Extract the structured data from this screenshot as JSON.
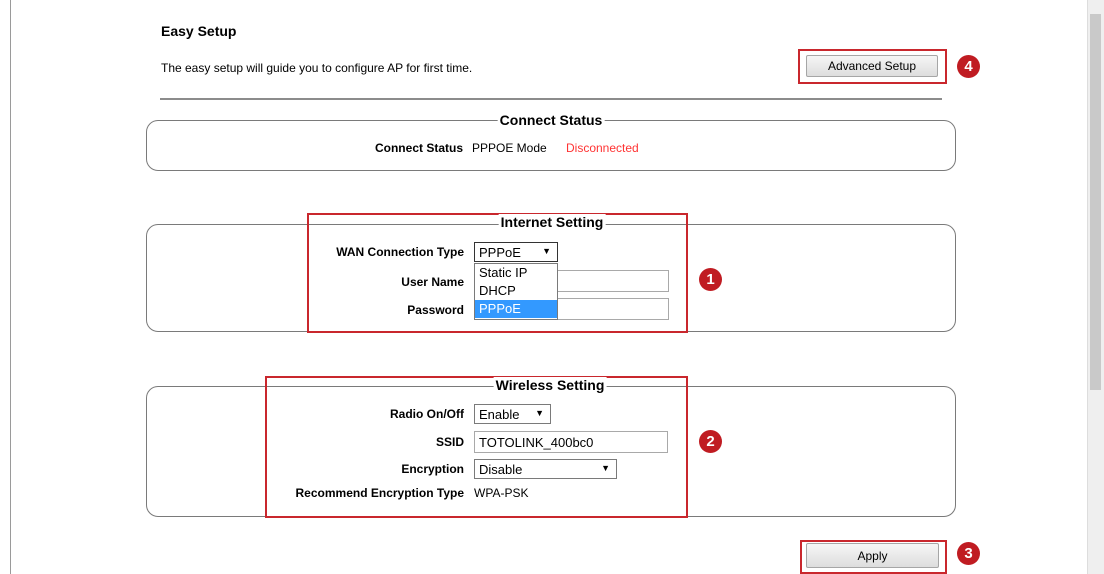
{
  "header": {
    "title": "Easy Setup",
    "description": "The easy setup will guide you to configure AP for first time.",
    "advanced_button": "Advanced Setup"
  },
  "connect_status": {
    "legend": "Connect Status",
    "label": "Connect Status",
    "mode": "PPPOE Mode",
    "state": "Disconnected",
    "state_color": "#ff3333"
  },
  "internet": {
    "legend": "Internet Setting",
    "wan_label": "WAN Connection Type",
    "wan_value": "PPPoE",
    "wan_options": [
      "Static IP",
      "DHCP",
      "PPPoE"
    ],
    "user_label": "User Name",
    "password_label": "Password"
  },
  "wireless": {
    "legend": "Wireless Setting",
    "radio_label": "Radio On/Off",
    "radio_value": "Enable",
    "ssid_label": "SSID",
    "ssid_value": "TOTOLINK_400bc0",
    "encryption_label": "Encryption",
    "encryption_value": "Disable",
    "recommend_label": "Recommend Encryption Type",
    "recommend_value": "WPA-PSK"
  },
  "apply_button": "Apply",
  "callouts": [
    "1",
    "2",
    "3",
    "4"
  ],
  "accent_color": "#c9272d",
  "icons": {
    "select_arrow": "chevron-down-icon"
  }
}
